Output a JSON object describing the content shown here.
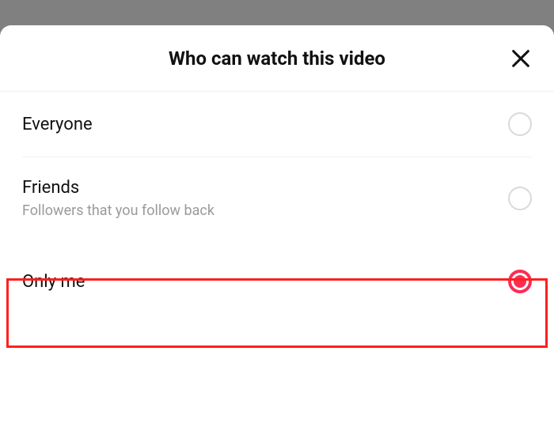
{
  "sheet": {
    "title": "Who can watch this video"
  },
  "options": {
    "everyone": {
      "label": "Everyone",
      "subtitle": "",
      "selected": false
    },
    "friends": {
      "label": "Friends",
      "subtitle": "Followers that you follow back",
      "selected": false
    },
    "only_me": {
      "label": "Only me",
      "subtitle": "",
      "selected": true
    }
  },
  "highlight": {
    "target": "only_me"
  },
  "colors": {
    "accent": "#fe2c55",
    "highlight_border": "#ff1f1f"
  }
}
